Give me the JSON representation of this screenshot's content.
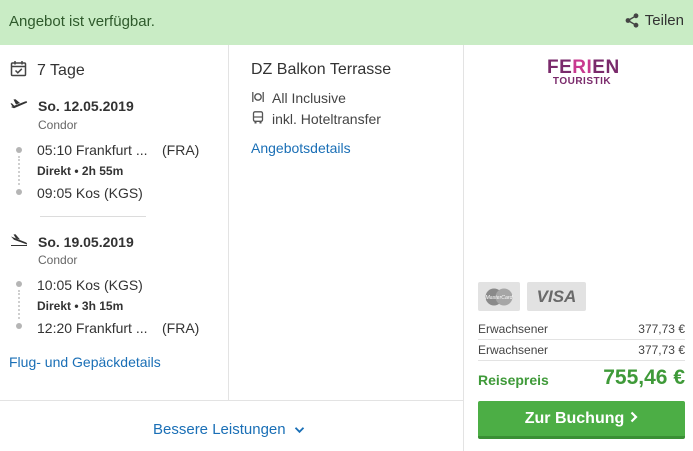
{
  "banner": {
    "message": "Angebot ist verfügbar.",
    "share_label": "Teilen",
    "color": "#c9ecc5"
  },
  "flight": {
    "duration": "7 Tage",
    "outbound": {
      "date": "So. 12.05.2019",
      "airline": "Condor",
      "dep_time_place": "05:10 Frankfurt ...",
      "dep_code": "(FRA)",
      "direct": "Direkt",
      "flight_time": "2h 55m",
      "arr_time_place": "09:05 Kos (KGS)"
    },
    "return": {
      "date": "So. 19.05.2019",
      "airline": "Condor",
      "dep_time_place": "10:05 Kos (KGS)",
      "direct": "Direkt",
      "flight_time": "3h 15m",
      "arr_time_place": "12:20 Frankfurt ...",
      "arr_code": "(FRA)"
    },
    "details_link": "Flug- und Gepäckdetails"
  },
  "hotel": {
    "room": "DZ Balkon Terrasse",
    "board": "All Inclusive",
    "transfer": "inkl. Hoteltransfer",
    "details_link": "Angebotsdetails"
  },
  "footer": {
    "more_label": "Bessere Leistungen"
  },
  "operator": {
    "logo_line1_a": "FE",
    "logo_line1_b": "RI",
    "logo_line1_c": "EN",
    "logo_line2": "TOURISTIK"
  },
  "pricing": {
    "cards": [
      "MasterCard",
      "VISA"
    ],
    "rows": [
      {
        "label": "Erwachsener",
        "value": "377,73 €"
      },
      {
        "label": "Erwachsener",
        "value": "377,73 €"
      }
    ],
    "total_label": "Reisepreis",
    "total_value": "755,46 €",
    "book_label": "Zur Buchung",
    "accent": "#4cae45"
  }
}
